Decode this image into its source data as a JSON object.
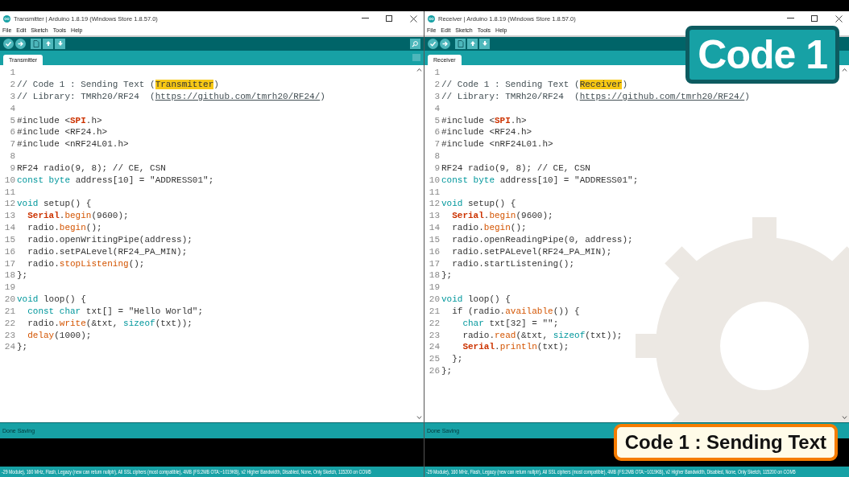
{
  "windows": [
    {
      "title": "Transmitter | Arduino 1.8.19 (Windows Store 1.8.57.0)",
      "menu": [
        "File",
        "Edit",
        "Sketch",
        "Tools",
        "Help"
      ],
      "tab": {
        "label": "Transmitter",
        "selected": true
      },
      "code": [
        {
          "number": "1"
        },
        {
          "number": "2",
          "segments": [
            {
              "kind": "comment",
              "text": "// Code 1 : Sending Text ("
            },
            {
              "kind": "mark",
              "text": "Transmitter"
            },
            {
              "kind": "comment",
              "text": ")"
            }
          ]
        },
        {
          "number": "3",
          "segments": [
            {
              "kind": "comment",
              "text": "// Library: TMRh20/RF24  ("
            },
            {
              "kind": "link",
              "text": "https://github.com/tmrh20/RF24/"
            },
            {
              "kind": "comment",
              "text": ")"
            }
          ]
        },
        {
          "number": "4"
        },
        {
          "number": "5",
          "segments": [
            {
              "kind": "plain",
              "text": "#include <"
            },
            {
              "kind": "library",
              "text": "SPI"
            },
            {
              "kind": "plain",
              "text": ".h>"
            }
          ]
        },
        {
          "number": "6",
          "segments": [
            {
              "kind": "plain",
              "text": "#include <RF24.h>"
            }
          ]
        },
        {
          "number": "7",
          "segments": [
            {
              "kind": "plain",
              "text": "#include <nRF24L01.h>"
            }
          ]
        },
        {
          "number": "8"
        },
        {
          "number": "9",
          "segments": [
            {
              "kind": "plain",
              "text": "RF24 radio(9, 8); // CE, CSN"
            }
          ]
        },
        {
          "number": "10",
          "segments": [
            {
              "kind": "type",
              "text": "const"
            },
            {
              "kind": "type",
              "text": " byte"
            },
            {
              "kind": "plain",
              "text": " address[10] = \"ADDRESS01\";"
            }
          ]
        },
        {
          "number": "11"
        },
        {
          "number": "12",
          "segments": [
            {
              "kind": "type",
              "text": "void"
            },
            {
              "kind": "plain",
              "text": " setup() {"
            }
          ]
        },
        {
          "number": "13",
          "segments": [
            {
              "kind": "library",
              "text": "  Serial"
            },
            {
              "kind": "plain",
              "text": "."
            },
            {
              "kind": "function",
              "text": "begin"
            },
            {
              "kind": "plain",
              "text": "(9600);"
            }
          ]
        },
        {
          "number": "14",
          "segments": [
            {
              "kind": "plain",
              "text": "  radio."
            },
            {
              "kind": "function",
              "text": "begin"
            },
            {
              "kind": "plain",
              "text": "();"
            }
          ]
        },
        {
          "number": "15",
          "segments": [
            {
              "kind": "plain",
              "text": "  radio.openWritingPipe(address);"
            }
          ]
        },
        {
          "number": "16",
          "segments": [
            {
              "kind": "plain",
              "text": "  radio.setPALevel(RF24_PA_MIN);"
            }
          ]
        },
        {
          "number": "17",
          "segments": [
            {
              "kind": "plain",
              "text": "  radio."
            },
            {
              "kind": "function",
              "text": "stopListening"
            },
            {
              "kind": "plain",
              "text": "();"
            }
          ]
        },
        {
          "number": "18",
          "segments": [
            {
              "kind": "plain",
              "text": "};"
            }
          ]
        },
        {
          "number": "19"
        },
        {
          "number": "20",
          "segments": [
            {
              "kind": "type",
              "text": "void"
            },
            {
              "kind": "plain",
              "text": " loop() {"
            }
          ]
        },
        {
          "number": "21",
          "segments": [
            {
              "kind": "type",
              "text": "  const"
            },
            {
              "kind": "type",
              "text": " char"
            },
            {
              "kind": "plain",
              "text": " txt[] = \"Hello World\";"
            }
          ]
        },
        {
          "number": "22",
          "segments": [
            {
              "kind": "plain",
              "text": "  radio."
            },
            {
              "kind": "function",
              "text": "write"
            },
            {
              "kind": "plain",
              "text": "(&txt, "
            },
            {
              "kind": "type",
              "text": "sizeof"
            },
            {
              "kind": "plain",
              "text": "(txt));"
            }
          ]
        },
        {
          "number": "23",
          "segments": [
            {
              "kind": "function",
              "text": "  delay"
            },
            {
              "kind": "plain",
              "text": "(1000);"
            }
          ]
        },
        {
          "number": "24",
          "segments": [
            {
              "kind": "plain",
              "text": "};"
            }
          ]
        }
      ],
      "status": "Done Saving",
      "board_info": "-29 Module), 160 MHz, Flash, Legacy (new can return nullptr), All SSL ciphers (most compatible), 4MB (FS:2MB OTA:~1019KB), v2 Higher Bandwidth, Disabled, None, Only Sketch, 115200 on COM5"
    },
    {
      "title": "Receiver | Arduino 1.8.19 (Windows Store 1.8.57.0)",
      "menu": [
        "File",
        "Edit",
        "Sketch",
        "Tools",
        "Help"
      ],
      "tab": {
        "label": "Receiver",
        "selected": true
      },
      "code": [
        {
          "number": "1"
        },
        {
          "number": "2",
          "segments": [
            {
              "kind": "comment",
              "text": "// Code 1 : Sending Text ("
            },
            {
              "kind": "mark",
              "text": "Receiver"
            },
            {
              "kind": "comment",
              "text": ")"
            }
          ]
        },
        {
          "number": "3",
          "segments": [
            {
              "kind": "comment",
              "text": "// Library: TMRh20/RF24  ("
            },
            {
              "kind": "link",
              "text": "https://github.com/tmrh20/RF24/"
            },
            {
              "kind": "comment",
              "text": ")"
            }
          ]
        },
        {
          "number": "4"
        },
        {
          "number": "5",
          "segments": [
            {
              "kind": "plain",
              "text": "#include <"
            },
            {
              "kind": "library",
              "text": "SPI"
            },
            {
              "kind": "plain",
              "text": ".h>"
            }
          ]
        },
        {
          "number": "6",
          "segments": [
            {
              "kind": "plain",
              "text": "#include <RF24.h>"
            }
          ]
        },
        {
          "number": "7",
          "segments": [
            {
              "kind": "plain",
              "text": "#include <nRF24L01.h>"
            }
          ]
        },
        {
          "number": "8"
        },
        {
          "number": "9",
          "segments": [
            {
              "kind": "plain",
              "text": "RF24 radio(9, 8); // CE, CSN"
            }
          ]
        },
        {
          "number": "10",
          "segments": [
            {
              "kind": "type",
              "text": "const"
            },
            {
              "kind": "type",
              "text": " byte"
            },
            {
              "kind": "plain",
              "text": " address[10] = \"ADDRESS01\";"
            }
          ]
        },
        {
          "number": "11"
        },
        {
          "number": "12",
          "segments": [
            {
              "kind": "type",
              "text": "void"
            },
            {
              "kind": "plain",
              "text": " setup() {"
            }
          ]
        },
        {
          "number": "13",
          "segments": [
            {
              "kind": "library",
              "text": "  Serial"
            },
            {
              "kind": "plain",
              "text": "."
            },
            {
              "kind": "function",
              "text": "begin"
            },
            {
              "kind": "plain",
              "text": "(9600);"
            }
          ]
        },
        {
          "number": "14",
          "segments": [
            {
              "kind": "plain",
              "text": "  radio."
            },
            {
              "kind": "function",
              "text": "begin"
            },
            {
              "kind": "plain",
              "text": "();"
            }
          ]
        },
        {
          "number": "15",
          "segments": [
            {
              "kind": "plain",
              "text": "  radio.openReadingPipe(0, address);"
            }
          ]
        },
        {
          "number": "16",
          "segments": [
            {
              "kind": "plain",
              "text": "  radio.setPALevel(RF24_PA_MIN);"
            }
          ]
        },
        {
          "number": "17",
          "segments": [
            {
              "kind": "plain",
              "text": "  radio.startListening();"
            }
          ]
        },
        {
          "number": "18",
          "segments": [
            {
              "kind": "plain",
              "text": "};"
            }
          ]
        },
        {
          "number": "19"
        },
        {
          "number": "20",
          "segments": [
            {
              "kind": "type",
              "text": "void"
            },
            {
              "kind": "plain",
              "text": " loop() {"
            }
          ]
        },
        {
          "number": "21",
          "segments": [
            {
              "kind": "plain",
              "text": "  if (radio."
            },
            {
              "kind": "function",
              "text": "available"
            },
            {
              "kind": "plain",
              "text": "()) {"
            }
          ]
        },
        {
          "number": "22",
          "segments": [
            {
              "kind": "type",
              "text": "    char"
            },
            {
              "kind": "plain",
              "text": " txt[32] = \"\";"
            }
          ]
        },
        {
          "number": "23",
          "segments": [
            {
              "kind": "plain",
              "text": "    radio."
            },
            {
              "kind": "function",
              "text": "read"
            },
            {
              "kind": "plain",
              "text": "(&txt, "
            },
            {
              "kind": "type",
              "text": "sizeof"
            },
            {
              "kind": "plain",
              "text": "(txt));"
            }
          ]
        },
        {
          "number": "24",
          "segments": [
            {
              "kind": "library",
              "text": "    Serial"
            },
            {
              "kind": "plain",
              "text": "."
            },
            {
              "kind": "function",
              "text": "println"
            },
            {
              "kind": "plain",
              "text": "(txt);"
            }
          ]
        },
        {
          "number": "25",
          "segments": [
            {
              "kind": "plain",
              "text": "  };"
            }
          ]
        },
        {
          "number": "26",
          "segments": [
            {
              "kind": "plain",
              "text": "};"
            }
          ]
        }
      ],
      "status": "Done Saving",
      "board_info": "-29 Module), 160 MHz, Flash, Legacy (new can return nullptr), All SSL ciphers (most compatible), 4MB (FS:2MB OTA:~1019KB), v2 Higher Bandwidth, Disabled, None, Only Sketch, 115200 on COM5"
    }
  ],
  "overlay": {
    "badge": "Code 1",
    "caption": "Code 1 : Sending Text"
  }
}
